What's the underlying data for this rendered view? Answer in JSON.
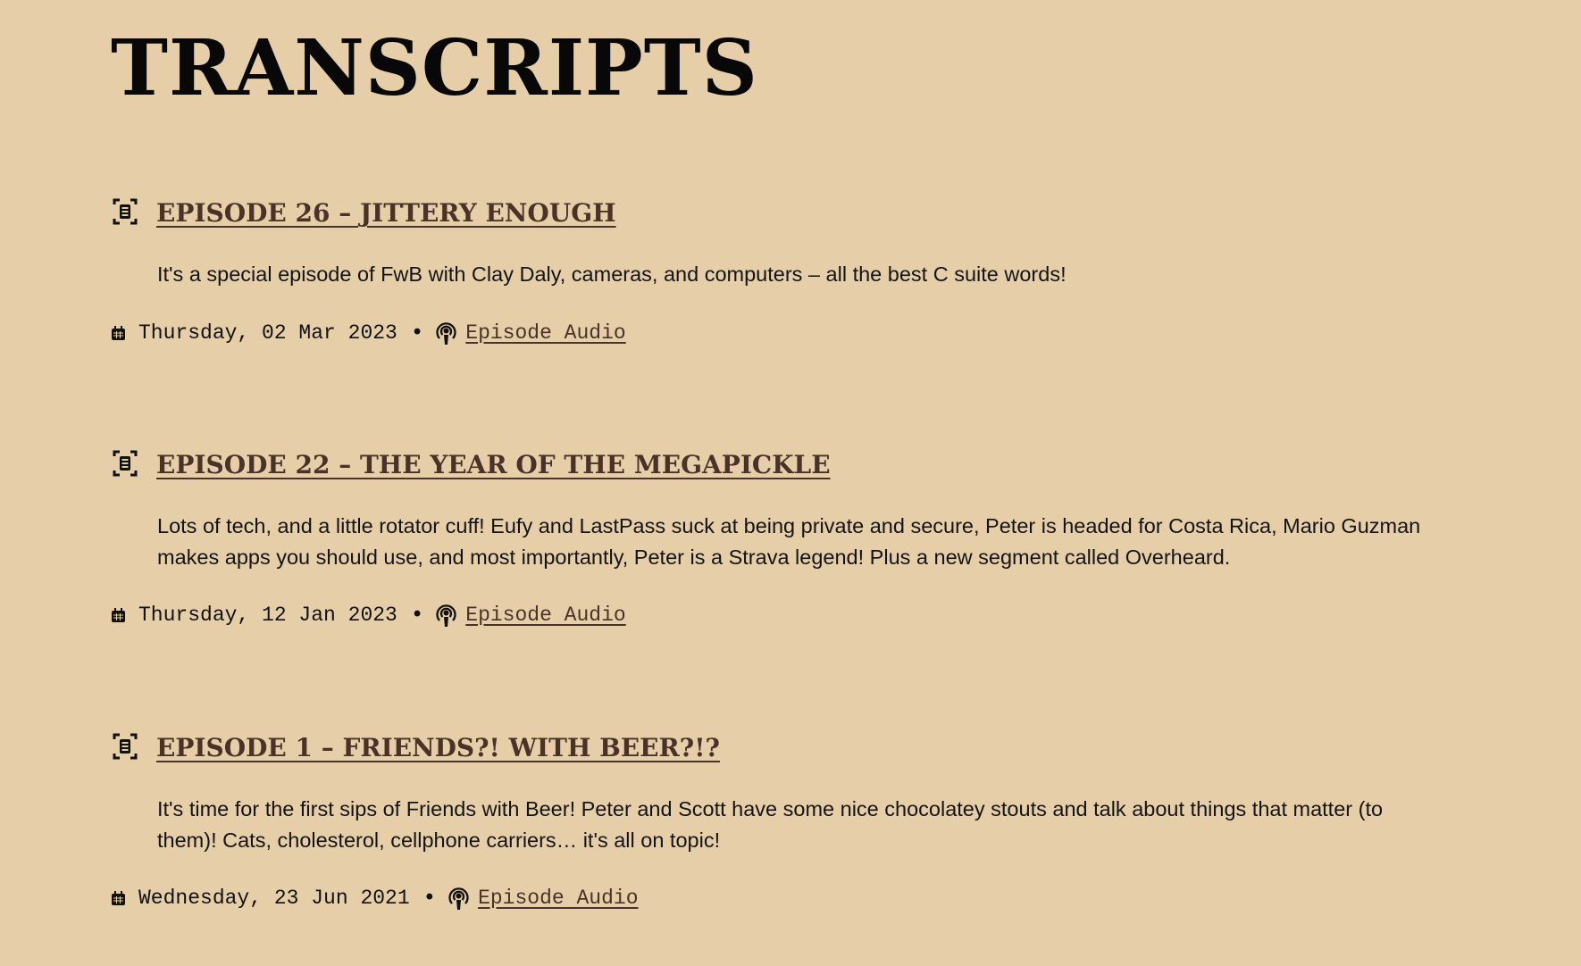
{
  "page": {
    "title": "TRANSCRIPTS"
  },
  "episodes": [
    {
      "title": "EPISODE 26 – JITTERY ENOUGH",
      "description": "It's a special episode of FwB with Clay Daly, cameras, and computers – all the best C suite words!",
      "date": "Thursday, 02 Mar 2023",
      "separator": "•",
      "audio_label": "Episode Audio"
    },
    {
      "title": "EPISODE 22 – THE YEAR OF THE MEGAPICKLE",
      "description": "Lots of tech, and a little rotator cuff! Eufy and LastPass suck at being private and secure, Peter is headed for Costa Rica, Mario Guzman makes apps you should use, and most importantly, Peter is a Strava legend! Plus a new segment called Overheard.",
      "date": "Thursday, 12 Jan 2023",
      "separator": "•",
      "audio_label": "Episode Audio"
    },
    {
      "title": "EPISODE 1 – FRIENDS?! WITH BEER?!?",
      "description": "It's time for the first sips of Friends with Beer! Peter and Scott have some nice chocolatey stouts and talk about things that matter (to them)! Cats, cholesterol, cellphone carriers… it's all on topic!",
      "date": "Wednesday, 23 Jun 2021",
      "separator": "•",
      "audio_label": "Episode Audio"
    }
  ],
  "icons": {
    "transcript": "transcript-icon",
    "calendar": "calendar-icon",
    "podcast": "podcast-icon"
  },
  "colors": {
    "background": "#e6cea9",
    "link": "#4b3228",
    "text": "#111111"
  }
}
